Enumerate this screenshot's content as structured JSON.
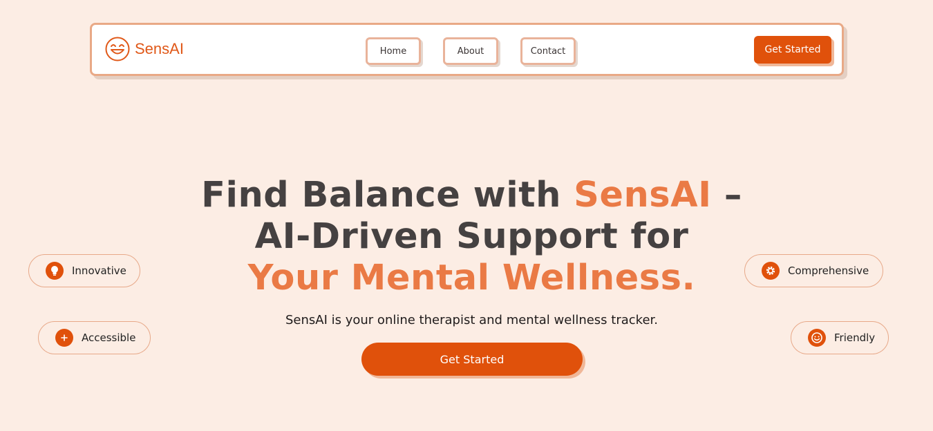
{
  "brand": {
    "name": "SensAI",
    "accent_color": "#e0510b",
    "highlight_color": "#ea7a45"
  },
  "nav": {
    "links": [
      {
        "label": "Home"
      },
      {
        "label": "About"
      },
      {
        "label": "Contact"
      }
    ],
    "cta_label": "Get Started"
  },
  "hero": {
    "title_part1": "Find Balance with ",
    "title_brand": "SensAI",
    "title_part2": " –",
    "title_line2": "AI-Driven Support for",
    "title_line3": "Your Mental Wellness.",
    "subtitle": "SensAI is your online therapist and mental wellness tracker.",
    "cta_label": "Get Started"
  },
  "features": [
    {
      "label": "Innovative",
      "icon": "lightbulb-icon"
    },
    {
      "label": "Accessible",
      "icon": "plus-icon"
    },
    {
      "label": "Comprehensive",
      "icon": "gear-icon"
    },
    {
      "label": "Friendly",
      "icon": "smiley-icon"
    }
  ]
}
